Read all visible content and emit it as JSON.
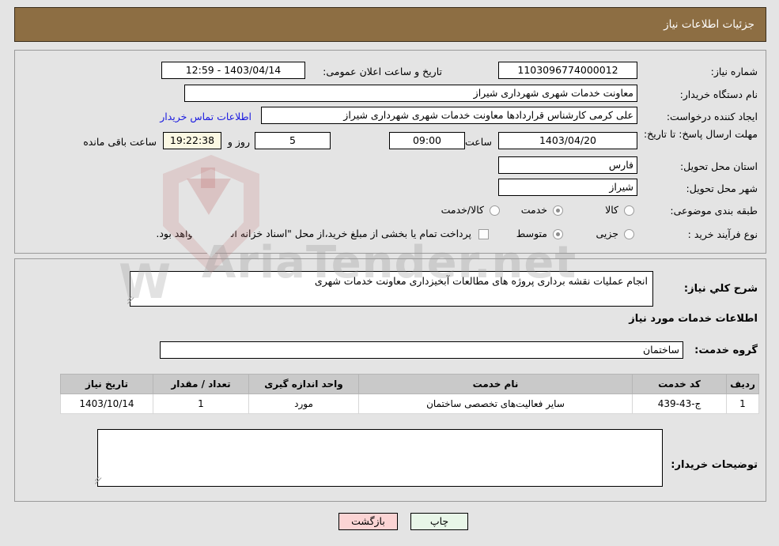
{
  "header": {
    "title": "جزئیات اطلاعات نیاز"
  },
  "form": {
    "need_number_label": "شماره نیاز:",
    "need_number_value": "1103096774000012",
    "announce_datetime_label": "تاریخ و ساعت اعلان عمومی:",
    "announce_datetime_value": "1403/04/14 - 12:59",
    "buyer_org_label": "نام دستگاه خریدار:",
    "buyer_org_value": "معاونت خدمات شهری شهرداری شیراز",
    "requester_label": "ایجاد کننده درخواست:",
    "requester_value": "علی کرمی کارشناس قراردادها معاونت خدمات شهری شهرداری شیراز",
    "contact_link": "اطلاعات تماس خریدار",
    "deadline_label": "مهلت ارسال پاسخ: تا تاریخ:",
    "deadline_date": "1403/04/20",
    "hour_label": "ساعت",
    "deadline_time": "09:00",
    "days_value": "5",
    "days_label": "روز و",
    "countdown_value": "19:22:38",
    "remaining_label": "ساعت باقی مانده",
    "province_label": "استان محل تحویل:",
    "province_value": "فارس",
    "city_label": "شهر محل تحویل:",
    "city_value": "شیراز",
    "category_label": "طبقه بندی موضوعی:",
    "category_options": [
      {
        "label": "کالا",
        "selected": false
      },
      {
        "label": "خدمت",
        "selected": true
      },
      {
        "label": "کالا/خدمت",
        "selected": false
      }
    ],
    "process_label": "نوع فرآیند خرید :",
    "process_options": [
      {
        "label": "جزیی",
        "selected": false
      },
      {
        "label": "متوسط",
        "selected": true
      }
    ],
    "treasury_checkbox_checked": false,
    "treasury_text": "پرداخت تمام یا بخشی از مبلغ خرید،از محل \"اسناد خزانه اسلامی\" خواهد بود."
  },
  "description": {
    "label": "شرح کلي نياز:",
    "value": "انجام عملیات نقشه برداری پروژه های مطالعات آبخیزداری معاونت خدمات شهری"
  },
  "services": {
    "section_title": "اطلاعات خدمات مورد نیاز",
    "group_label": "گروه خدمت:",
    "group_value": "ساختمان",
    "columns": [
      "ردیف",
      "کد خدمت",
      "نام خدمت",
      "واحد اندازه گیری",
      "تعداد / مقدار",
      "تاریخ نیاز"
    ],
    "rows": [
      {
        "row": "1",
        "code": "ج-43-439",
        "name": "سایر فعالیت‌های تخصصی ساختمان",
        "unit": "مورد",
        "qty": "1",
        "date": "1403/10/14"
      }
    ]
  },
  "buyer_notes": {
    "label": "توضیحات خریدار:",
    "value": ""
  },
  "actions": {
    "print_label": "چاپ",
    "back_label": "بازگشت"
  },
  "watermark": {
    "text": "AriaTender.net"
  },
  "colors": {
    "header_brown": "#8d6e43",
    "page_bg": "#e4e4e4",
    "link_blue": "#1a1ae0",
    "print_btn": "#e8f6e8",
    "back_btn": "#fbd4d4",
    "countdown_bg": "#fbf8e3"
  }
}
